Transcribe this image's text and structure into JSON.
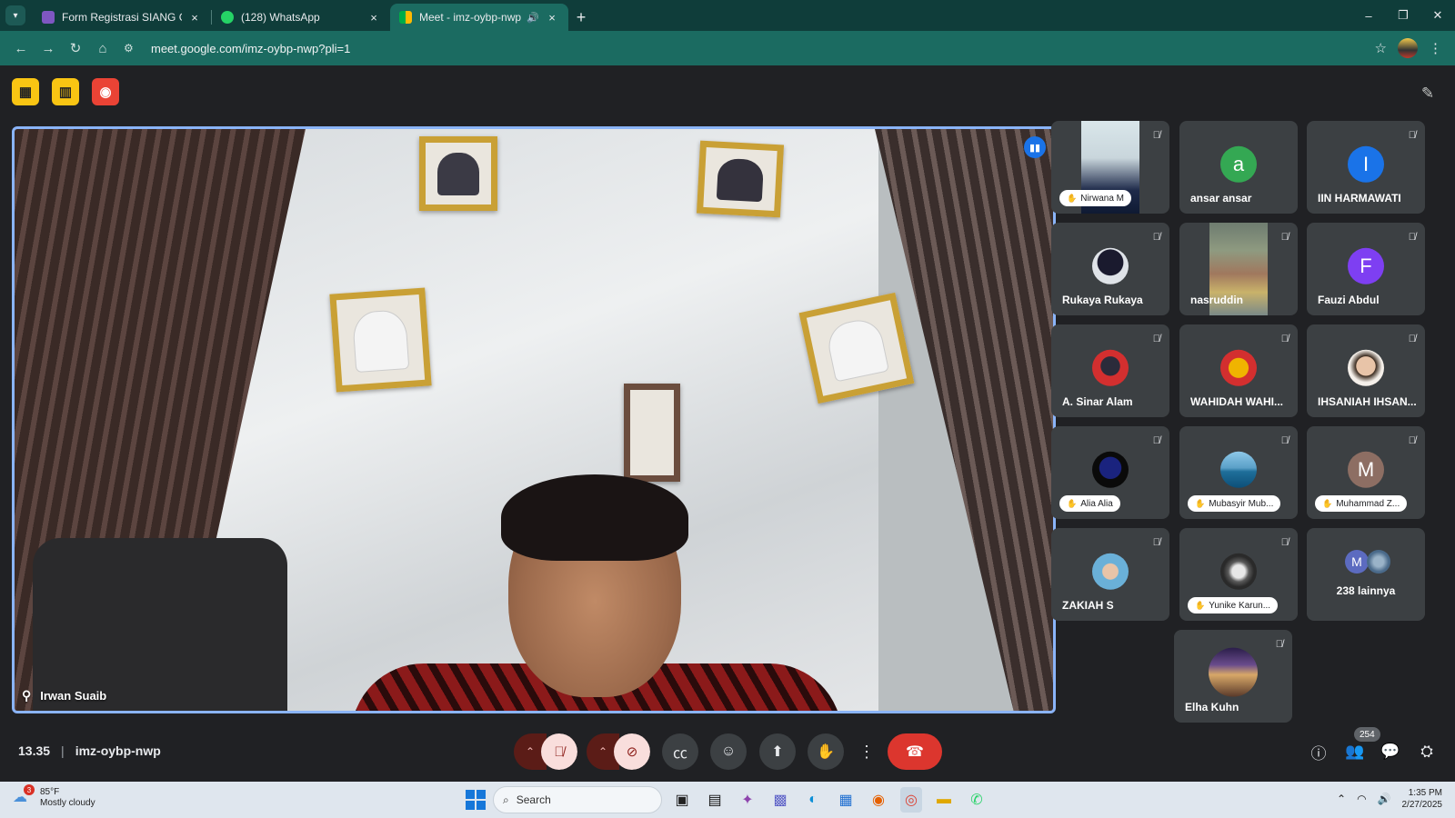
{
  "browser": {
    "tabs": [
      {
        "title": "Form Registrasi SIANG GEG - K",
        "close": "×",
        "favicon_color": "#7e57c2"
      },
      {
        "title": "(128) WhatsApp",
        "close": "×",
        "favicon_color": "#25d366"
      },
      {
        "title": "Meet - imz-oybp-nwp",
        "close": "×",
        "favicon_color": "#00ac47",
        "audio": "🔊"
      }
    ],
    "new_tab": "+",
    "url": "meet.google.com/imz-oybp-nwp?pli=1",
    "window_controls": [
      "–",
      "❐",
      "✕"
    ]
  },
  "main_speaker": {
    "name": "Irwan Suaib"
  },
  "participants": [
    {
      "name": "Nirwana M",
      "style": "pill",
      "video": true
    },
    {
      "name": "ansar ansar",
      "initial": "a",
      "color": "#34a853"
    },
    {
      "name": "IIN HARMAWATI",
      "initial": "I",
      "color": "#1a73e8"
    },
    {
      "name": "Rukaya Rukaya",
      "avatar": "photo"
    },
    {
      "name": "nasruddin",
      "video": true
    },
    {
      "name": "Fauzi Abdul",
      "initial": "F",
      "color": "#7e3ff2"
    },
    {
      "name": "A. Sinar Alam",
      "avatar": "photo"
    },
    {
      "name": "WAHIDAH WAHI...",
      "avatar": "photo"
    },
    {
      "name": "IHSANIAH IHSAN...",
      "avatar": "photo"
    },
    {
      "name": "Alia Alia",
      "style": "pill",
      "avatar": "photo"
    },
    {
      "name": "Mubasyir Mub...",
      "style": "pill",
      "avatar": "photo"
    },
    {
      "name": "Muhammad Z...",
      "style": "pill",
      "initial": "M",
      "color": "#8d6e63"
    },
    {
      "name": "ZAKIAH S",
      "avatar": "photo"
    },
    {
      "name": "Yunike Karun...",
      "style": "pill",
      "avatar": "photo"
    },
    {
      "name": "238 lainnya",
      "initial": "M",
      "others": true
    },
    {
      "name": "Elha Kuhn",
      "avatar": "photo"
    }
  ],
  "meeting": {
    "time": "13.35",
    "separator": "|",
    "code": "imz-oybp-nwp",
    "people_count": "254"
  },
  "taskbar": {
    "weather_temp": "85°F",
    "weather_desc": "Mostly cloudy",
    "weather_badge": "3",
    "search_placeholder": "Search",
    "time": "1:35 PM",
    "date": "2/27/2025"
  }
}
